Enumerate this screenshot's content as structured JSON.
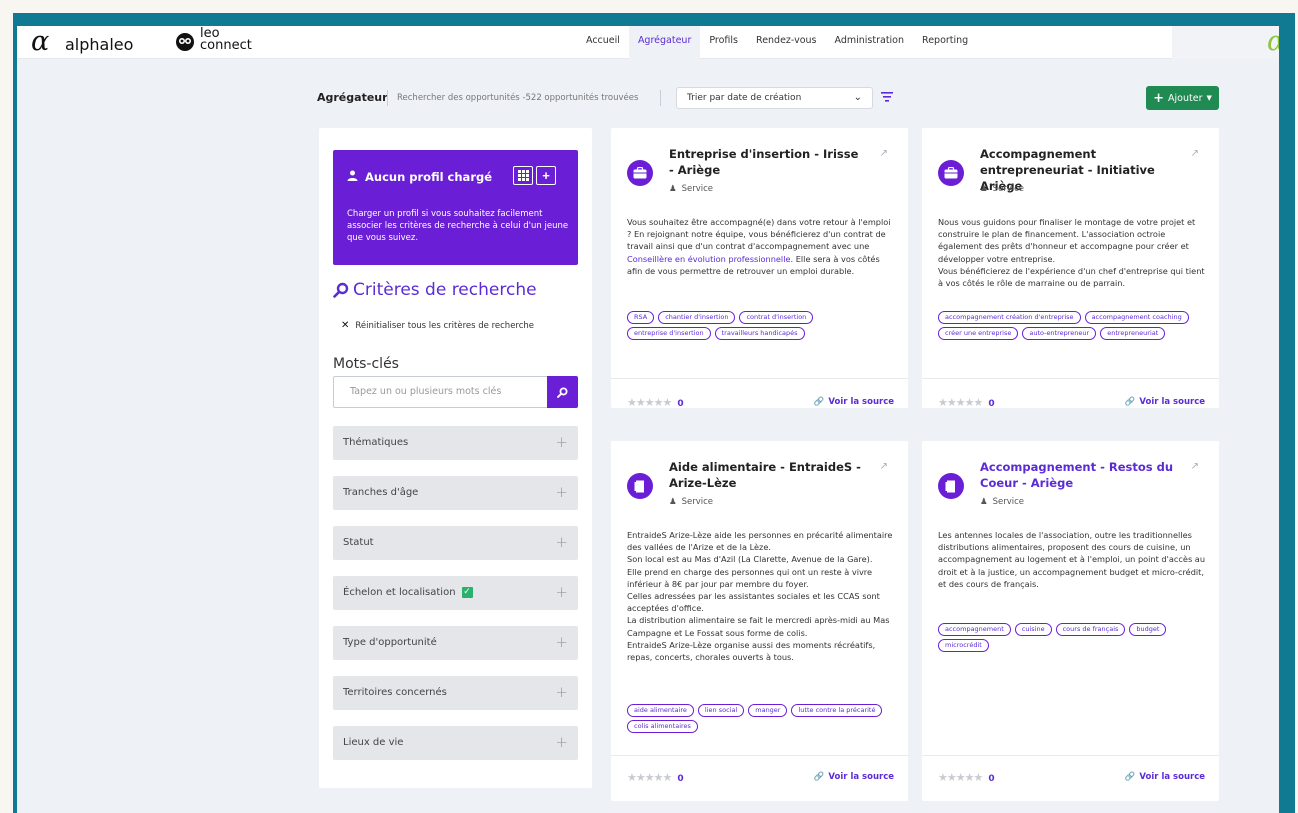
{
  "nav": {
    "logo_alpha_symbol": "α",
    "logo_alpha_text": "alphaleo",
    "logo_leo_text_1": "leo",
    "logo_leo_text_2": "connect",
    "links": [
      "Accueil",
      "Agrégateur",
      "Profils",
      "Rendez-vous",
      "Administration",
      "Reporting"
    ],
    "active": "Agrégateur",
    "right_logo_symbol": "α"
  },
  "toolbar": {
    "title": "Agrégateur",
    "description": "Rechercher des opportunités -522 opportunités trouvées",
    "sort_select": "Trier par date de création",
    "add_button": "Ajouter"
  },
  "sidebar": {
    "profile_title": "Aucun profil chargé",
    "profile_text": "Charger un profil si vous souhaitez facilement associer les critères de recherche à celui d'un jeune que vous suivez.",
    "criteria_title": "Critères de recherche",
    "reset_label": "Réinitialiser tous les critères de recherche",
    "keywords_title": "Mots-clés",
    "keywords_placeholder": "Tapez un ou plusieurs mots clés",
    "filters": [
      {
        "label": "Thématiques",
        "checked": false
      },
      {
        "label": "Tranches d'âge",
        "checked": false
      },
      {
        "label": "Statut",
        "checked": false
      },
      {
        "label": "Échelon et localisation",
        "checked": true
      },
      {
        "label": "Type d'opportunité",
        "checked": false
      },
      {
        "label": "Territoires concernés",
        "checked": false
      },
      {
        "label": "Lieux de vie",
        "checked": false
      }
    ]
  },
  "cards": [
    {
      "title": "Entreprise d'insertion - Irisse - Ariège",
      "type": "Service",
      "icon": "briefcase-icon",
      "desc_before": "Vous souhaitez être accompagné(e) dans votre retour à l'emploi ? En rejoignant notre équipe, vous bénéficierez d'un contrat de travail ainsi que d'un contrat d'accompagnement avec une ",
      "desc_link": "Conseillère en évolution professionnelle",
      "desc_after": ". Elle sera à vos côtés afin de vous permettre de retrouver un emploi durable.",
      "tags": [
        "RSA",
        "chantier d'insertion",
        "contrat d'insertion",
        "entreprise d'insertion",
        "travailleurs handicapés"
      ],
      "rating": "0",
      "source": "Voir la source"
    },
    {
      "title": "Accompagnement entrepreneuriat - Initiative Ariège",
      "type": "Service",
      "icon": "briefcase-icon",
      "desc_before": "Nous vous guidons pour finaliser le montage de votre projet et construire le plan de financement. L'association octroie également des prêts d'honneur et accompagne pour créer et développer votre entreprise.\nVous bénéficierez de l'expérience d'un chef d'entreprise qui tient à vos côtés le rôle de marraine ou de parrain.",
      "desc_link": "",
      "desc_after": "",
      "tags": [
        "accompagnement création d'entreprise",
        "accompagnement coaching",
        "créer une entreprise",
        "auto-entrepreneur",
        "entrepreneuriat"
      ],
      "rating": "0",
      "source": "Voir la source"
    },
    {
      "title": "Aide alimentaire - EntraideS - Arize-Lèze",
      "type": "Service",
      "icon": "document-icon",
      "desc_before": "EntraideS Arize-Lèze aide les personnes en précarité alimentaire des vallées de l'Arize et de la Lèze.\nSon local est au Mas d'Azil (La Clarette, Avenue de la Gare).\nElle prend en charge des personnes qui ont un reste à vivre inférieur à 8€ par jour par membre du foyer.\nCelles adressées par les assistantes sociales et les CCAS sont acceptées d'office.\nLa distribution alimentaire se fait le mercredi après-midi au Mas Campagne et Le Fossat sous forme de colis.\nEntraideS Arize-Lèze organise aussi des moments récréatifs, repas, concerts, chorales ouverts à tous.",
      "desc_link": "",
      "desc_after": "",
      "tags": [
        "aide alimentaire",
        "lien social",
        "manger",
        "lutte contre la précarité",
        "colis alimentaires"
      ],
      "rating": "0",
      "source": "Voir la source"
    },
    {
      "title": "Accompagnement - Restos du Coeur - Ariège",
      "type": "Service",
      "icon": "document-icon",
      "desc_before": "Les antennes locales de l'association, outre les traditionnelles distributions alimentaires, proposent des cours de cuisine, un accompagnement au logement et à l'emploi, un point d'accès au droit et à la justice, un accompagnement budget et micro-crédit, et des cours de français.",
      "desc_link": "",
      "desc_after": "",
      "tags": [
        "accompagnement",
        "cuisine",
        "cours de français",
        "budget",
        "microcrédit"
      ],
      "rating": "0",
      "source": "Voir la source"
    }
  ]
}
